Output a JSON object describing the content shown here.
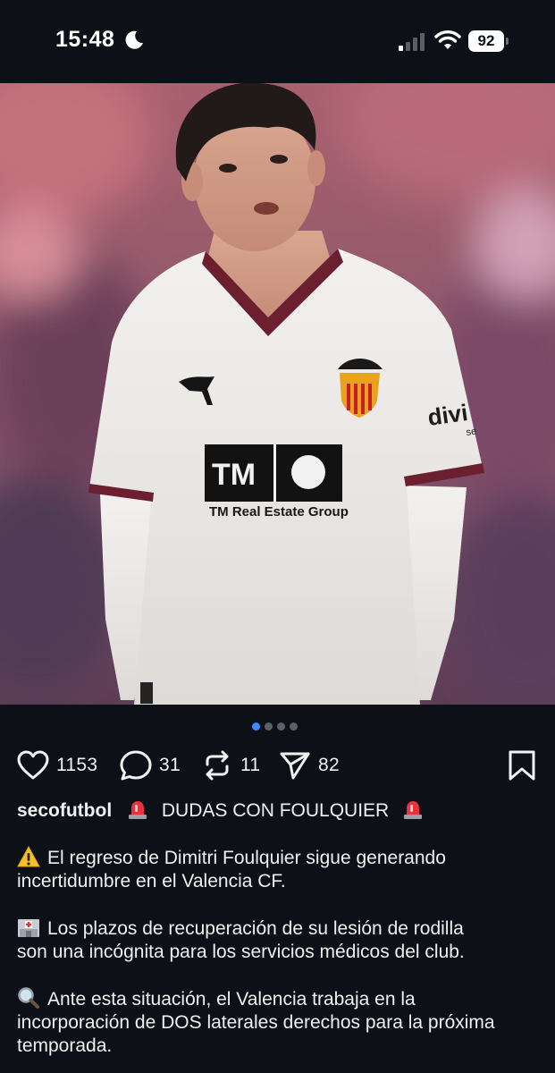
{
  "status_bar": {
    "time": "15:48",
    "battery": "92",
    "icons": [
      "moon-icon",
      "signal-icon",
      "wifi-icon",
      "battery-icon"
    ]
  },
  "post": {
    "image": {
      "description_elements": [
        "player-photo"
      ],
      "jersey_sponsor": "TM Real Estate Group",
      "jersey_logo_text": "TM",
      "sleeve_sponsor": "divi",
      "sleeve_sponsor_sub": "se"
    },
    "carousel": {
      "count": 4,
      "active": 0
    },
    "actions": {
      "likes": "1153",
      "comments": "31",
      "reposts": "11",
      "shares": "82"
    },
    "caption": {
      "username": "secofutbol",
      "headline": "DUDAS CON FOULQUIER",
      "paragraphs": [
        {
          "emoji": "warning-icon",
          "lines": [
            "El regreso de Dimitri Foulquier sigue generando",
            "incertidumbre en el Valencia CF."
          ]
        },
        {
          "emoji": "hospital-icon",
          "lines": [
            "Los plazos de recuperación de su lesión de rodilla",
            "son una incógnita para los servicios médicos del club."
          ]
        },
        {
          "emoji": "magnifier-icon",
          "lines": [
            "Ante esta situación, el Valencia trabaja en la",
            "incorporación de DOS laterales derechos para la próxima",
            "temporada."
          ]
        }
      ]
    }
  },
  "colors": {
    "background": "#0d1016",
    "accent_dot": "#3d8bff",
    "jersey_trim": "#6b1f2f"
  }
}
